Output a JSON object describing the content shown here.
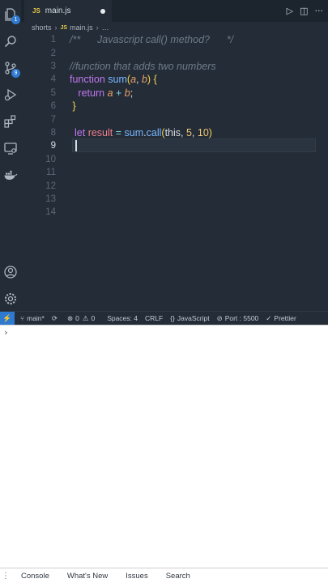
{
  "tab": {
    "lang_badge": "JS",
    "filename": "main.js"
  },
  "breadcrumb": {
    "folder": "shorts",
    "lang_badge": "JS",
    "file": "main.js",
    "ellipsis": "…"
  },
  "activity_badges": {
    "explorer": "1",
    "source_control": "9"
  },
  "line_numbers": [
    "1",
    "2",
    "3",
    "4",
    "5",
    "6",
    "7",
    "8",
    "9",
    "10",
    "11",
    "12",
    "13",
    "14"
  ],
  "active_line": "9",
  "code": {
    "line1": "/**      Javascript call() method?      */",
    "line3": "//function that adds two numbers",
    "l4_kw": "function",
    "l4_fn": "sum",
    "l4_open": "(",
    "l4_a": "a",
    "l4_comma": ", ",
    "l4_b": "b",
    "l4_close": ")",
    "l4_brace": " {",
    "l5_indent": "   ",
    "l5_kw": "return",
    "l5_a": "a",
    "l5_plus": " + ",
    "l5_b": "b",
    "l5_semi": ";",
    "l6_brace": " }",
    "l8_kw": "let",
    "l8_var": "result",
    "l8_eq": " = ",
    "l8_obj": "sum",
    "l8_dot": ".",
    "l8_call": "call",
    "l8_open": "(",
    "l8_this": "this",
    "l8_c1": ", ",
    "l8_n1": "5",
    "l8_c2": ", ",
    "l8_n2": "10",
    "l8_close": ")"
  },
  "statusbar": {
    "remote": "⚡",
    "branch": "main*",
    "sync": "",
    "errors": "0",
    "warnings": "0",
    "spaces": "Spaces: 4",
    "eol": "CRLF",
    "language": "JavaScript",
    "port": "Port : 5500",
    "formatter": "Prettier"
  },
  "console": {
    "prompt": "›"
  },
  "drawer": {
    "tabs": [
      "Console",
      "What's New",
      "Issues",
      "Search"
    ]
  }
}
